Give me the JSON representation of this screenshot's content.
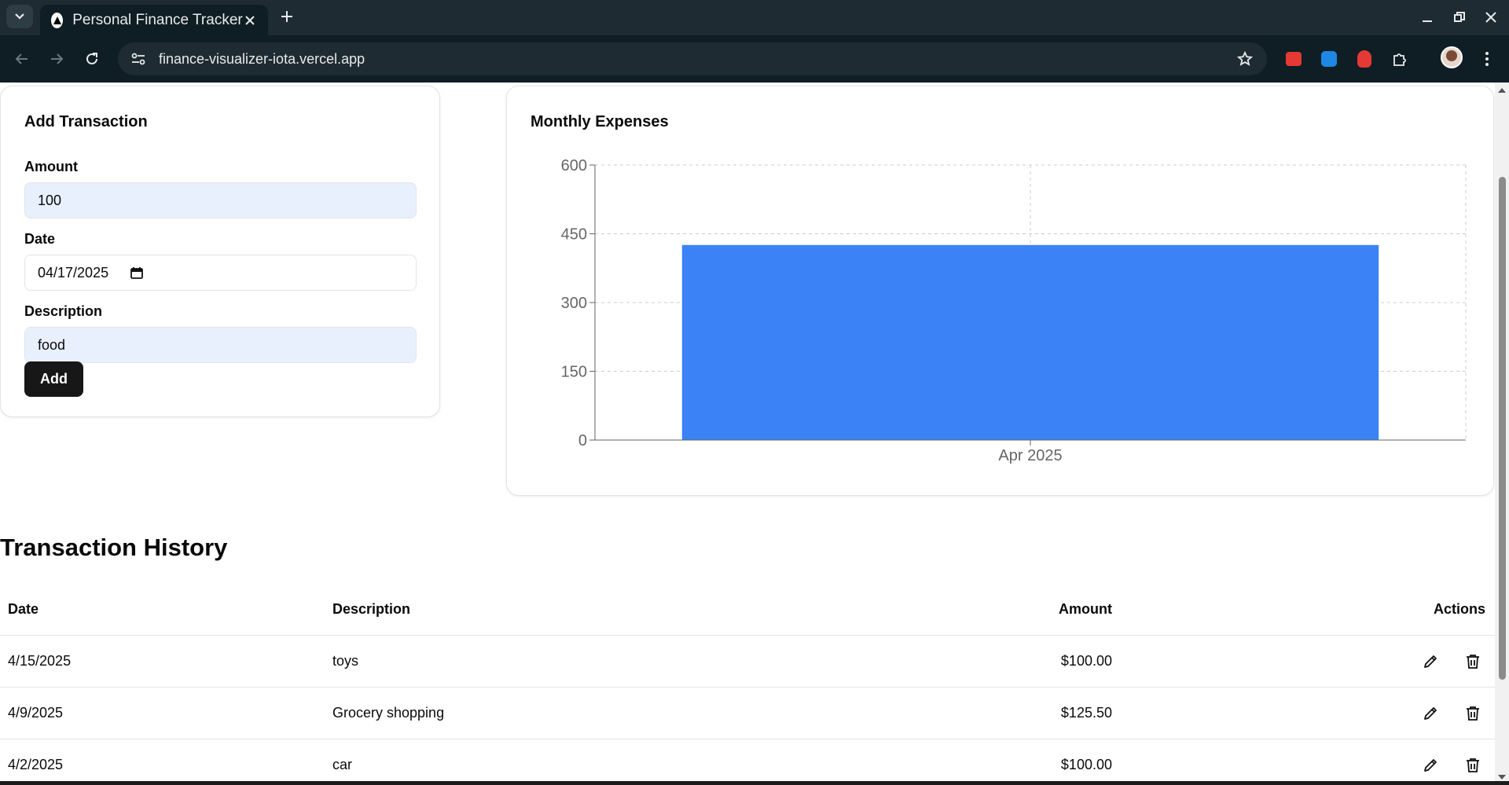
{
  "browser": {
    "tab_title": "Personal Finance Tracker",
    "url": "finance-visualizer-iota.vercel.app"
  },
  "form": {
    "title": "Add Transaction",
    "amount_label": "Amount",
    "amount_value": "100",
    "date_label": "Date",
    "date_value": "04/17/2025",
    "description_label": "Description",
    "description_value": "food",
    "submit_label": "Add"
  },
  "chart": {
    "title": "Monthly Expenses"
  },
  "chart_data": {
    "type": "bar",
    "title": "Monthly Expenses",
    "categories": [
      "Apr 2025"
    ],
    "values": [
      425.5
    ],
    "ylim": [
      0,
      600
    ],
    "yticks": [
      0,
      150,
      300,
      450,
      600
    ],
    "grid": true,
    "bar_color": "#3b82f6",
    "xlabel": "",
    "ylabel": ""
  },
  "history": {
    "title": "Transaction History",
    "columns": {
      "date": "Date",
      "description": "Description",
      "amount": "Amount",
      "actions": "Actions"
    },
    "rows": [
      {
        "date": "4/15/2025",
        "description": "toys",
        "amount": "$100.00"
      },
      {
        "date": "4/9/2025",
        "description": "Grocery shopping",
        "amount": "$125.50"
      },
      {
        "date": "4/2/2025",
        "description": "car",
        "amount": "$100.00"
      }
    ]
  },
  "icons": {
    "edit": "pencil-icon",
    "delete": "trash-icon"
  },
  "colors": {
    "accent": "#3b82f6",
    "button": "#171717",
    "autofill": "#e8f0fe"
  }
}
